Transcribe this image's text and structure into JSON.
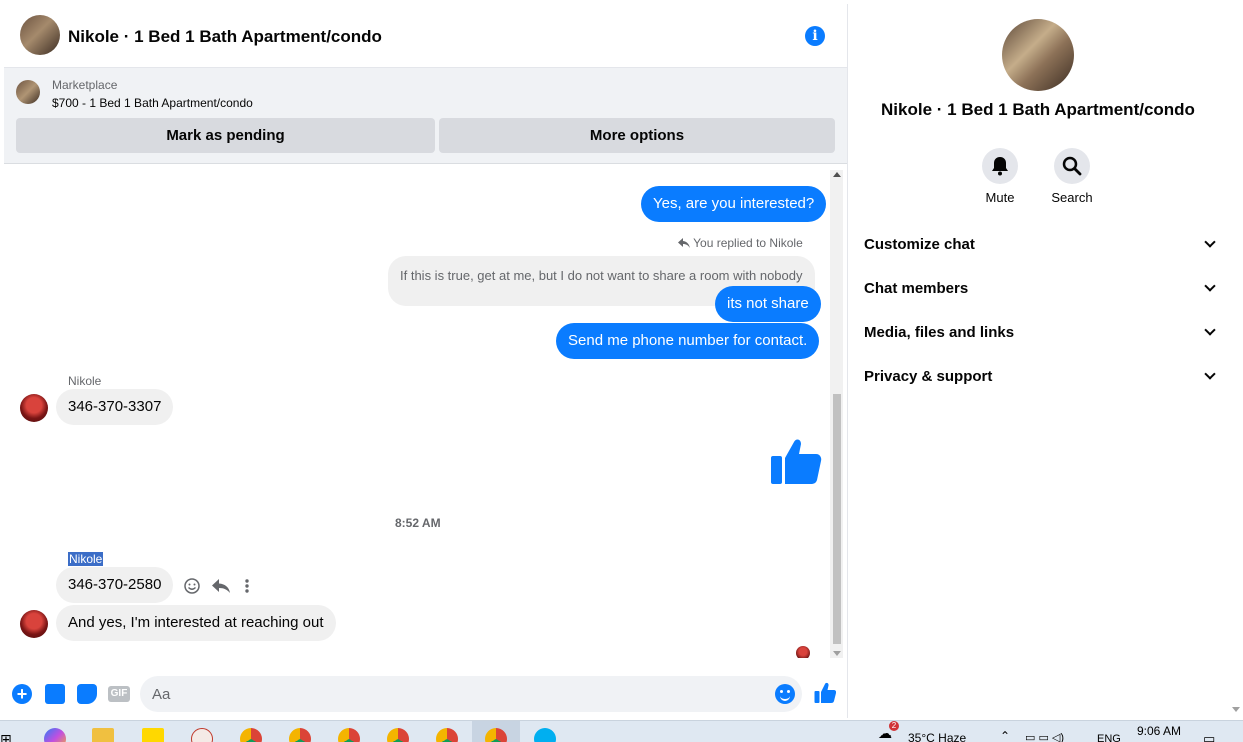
{
  "header": {
    "title": "Nikole · 1 Bed 1 Bath Apartment/condo",
    "info_glyph": "i"
  },
  "marketplace": {
    "label": "Marketplace",
    "listing": "$700 - 1 Bed 1 Bath Apartment/condo",
    "buttons": {
      "pending": "Mark as pending",
      "more": "More options"
    }
  },
  "messages": {
    "m1": "Yes, are you interested?",
    "replied_note": "You replied to Nikole",
    "quoted": "If this is true, get at me, but I do not want to share a room with nobody",
    "m2": "its not share",
    "m3": "Send me phone number for contact.",
    "sender1": "Nikole",
    "m4": "346-370-3307",
    "time": "8:52 AM",
    "sender2": "Nikole",
    "m5": "346-370-2580",
    "m6": "And yes, I'm interested at reaching out"
  },
  "composer": {
    "placeholder": "Aa",
    "gif_label": "GIF",
    "plus_glyph": "+"
  },
  "right_pane": {
    "title": "Nikole · 1 Bed 1 Bath Apartment/condo",
    "actions": [
      {
        "label": "Mute",
        "icon": "bell-icon"
      },
      {
        "label": "Search",
        "icon": "search-icon"
      }
    ],
    "sections": [
      "Customize chat",
      "Chat members",
      "Media, files and links",
      "Privacy & support"
    ]
  },
  "taskbar": {
    "weather": "35°C  Haze",
    "lang": "ENG",
    "time": "9:06 AM",
    "notif_count": "2"
  },
  "colors": {
    "accent": "#0a7cff",
    "bubble_in": "#f0f0f0"
  }
}
